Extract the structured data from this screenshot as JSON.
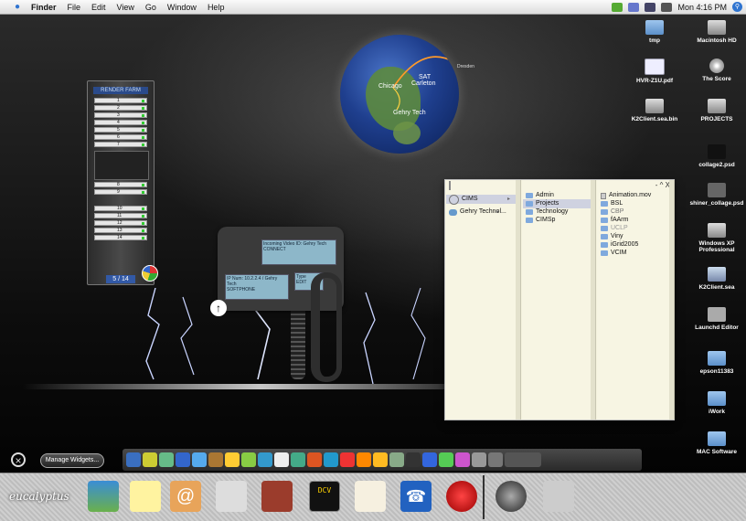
{
  "menubar": {
    "app_name": "Finder",
    "menus": [
      "File",
      "Edit",
      "View",
      "Go",
      "Window",
      "Help"
    ],
    "clock": "Mon 4:16 PM"
  },
  "globe": {
    "cities": [
      "Chicago",
      "SAT",
      "Carleton",
      "Gehry Tech",
      "Dresden"
    ]
  },
  "render_farm": {
    "title": "RENDER FARM",
    "slots": [
      "1",
      "2",
      "3",
      "4",
      "5",
      "6",
      "7",
      "8",
      "9",
      "10",
      "11",
      "12",
      "13",
      "14"
    ],
    "counter": "5 / 14"
  },
  "phone": {
    "lcd_top": "Incoming Video ID: Gehry Tech",
    "lcd_top2": "CONNECT",
    "lcd_left": "IP Num: 10.2.2.4 / Gehry Tech",
    "lcd_left2": "SOFTPHONE",
    "lcd_right": "Type",
    "lcd_right2": "EDIT"
  },
  "finder_window": {
    "controls": "- ^ X",
    "column1": [
      {
        "label": "CIMS",
        "selected": true
      },
      {
        "label": "Gehry Technol...",
        "selected": false
      }
    ],
    "column2": [
      {
        "label": "Admin",
        "selected": false
      },
      {
        "label": "Projects",
        "selected": true
      },
      {
        "label": "Technology",
        "selected": false
      },
      {
        "label": "CIMSp",
        "selected": false
      }
    ],
    "column3": [
      {
        "label": "Animation.mov",
        "kind": "file"
      },
      {
        "label": "BSL",
        "kind": "folder"
      },
      {
        "label": "CBP",
        "kind": "folder"
      },
      {
        "label": "fAArm",
        "kind": "folder"
      },
      {
        "label": "UCLP",
        "kind": "folder"
      },
      {
        "label": "Viny",
        "kind": "folder"
      },
      {
        "label": "iGrid2005",
        "kind": "folder"
      },
      {
        "label": "VCIM",
        "kind": "folder"
      }
    ]
  },
  "desktop_icons": [
    {
      "label": "tmp",
      "icon": "folder-icon"
    },
    {
      "label": "Macintosh HD",
      "icon": "hard-disk-icon"
    },
    {
      "label": "HVR-Z1U.pdf",
      "icon": "pdf-icon"
    },
    {
      "label": "The Score",
      "icon": "cd-icon"
    },
    {
      "label": "K2Client.sea.bin",
      "icon": "archive-icon"
    },
    {
      "label": "PROJECTS",
      "icon": "network-disk-icon"
    },
    {
      "label": "collage2.psd",
      "icon": "image-icon"
    },
    {
      "label": "shiner_collage.psd",
      "icon": "image-icon"
    },
    {
      "label": "Windows XP Professional",
      "icon": "disk-image-icon"
    },
    {
      "label": "K2Client.sea",
      "icon": "vise-icon"
    },
    {
      "label": "Launchd Editor",
      "icon": "app-icon"
    },
    {
      "label": "epson11383",
      "icon": "folder-icon"
    },
    {
      "label": "iWork",
      "icon": "folder-icon"
    },
    {
      "label": "MAC Software",
      "icon": "folder-icon"
    }
  ],
  "widget_bar": {
    "manage_label": "Manage Widgets..."
  },
  "dock": {
    "brand": "eucalyptus",
    "dcv_label": "DCV"
  }
}
